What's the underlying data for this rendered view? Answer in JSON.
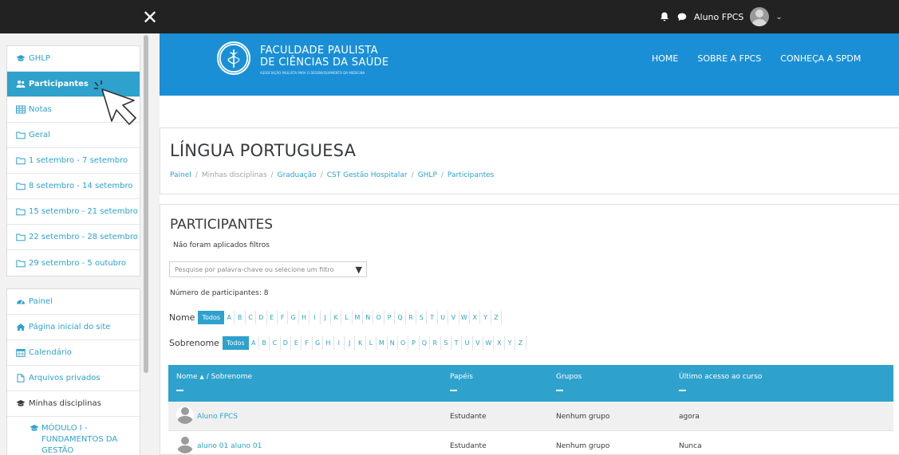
{
  "topbar": {
    "close_glyph": "✕",
    "user_name": "Aluno FPCS",
    "caret": "⌄",
    "icons": [
      "bell-icon",
      "chat-icon"
    ]
  },
  "sidebar": {
    "course_items": [
      {
        "label": "GHLP",
        "icon": "graduation-cap-icon",
        "active": false
      },
      {
        "label": "Participantes",
        "icon": "users-icon",
        "active": true
      },
      {
        "label": "Notas",
        "icon": "table-icon",
        "active": false
      },
      {
        "label": "Geral",
        "icon": "folder-icon",
        "active": false
      },
      {
        "label": "1 setembro - 7 setembro",
        "icon": "folder-icon",
        "active": false
      },
      {
        "label": "8 setembro - 14 setembro",
        "icon": "folder-icon",
        "active": false
      },
      {
        "label": "15 setembro - 21 setembro",
        "icon": "folder-icon",
        "active": false
      },
      {
        "label": "22 setembro - 28 setembro",
        "icon": "folder-icon",
        "active": false
      },
      {
        "label": "29 setembro - 5 outubro",
        "icon": "folder-icon",
        "active": false
      }
    ],
    "site_items": [
      {
        "label": "Painel",
        "icon": "dashboard-icon"
      },
      {
        "label": "Página inicial do site",
        "icon": "home-icon"
      },
      {
        "label": "Calendário",
        "icon": "calendar-icon"
      },
      {
        "label": "Arquivos privados",
        "icon": "file-icon"
      },
      {
        "label": "Minhas disciplinas",
        "icon": "graduation-cap-icon"
      }
    ],
    "sub_item": "MÓDULO I - FUNDAMENTOS DA GESTÃO"
  },
  "header": {
    "brand_line1": "FACULDADE PAULISTA",
    "brand_line2": "DE CIÊNCIAS DA SAÚDE",
    "brand_line3": "ASSOCIAÇÃO PAULISTA PARA O DESENVOLVIMENTO DA MEDICINA",
    "logo_text": "SPDM",
    "nav": [
      "HOME",
      "SOBRE A FPCS",
      "CONHEÇA A SPDM"
    ]
  },
  "page": {
    "title": "LÍNGUA PORTUGUESA",
    "breadcrumb": [
      "Painel",
      "Minhas disciplinas",
      "Graduação",
      "CST Gestão Hospitalar",
      "GHLP",
      "Participantes"
    ],
    "breadcrumb_sep": "/"
  },
  "participants": {
    "title": "PARTICIPANTES",
    "no_filters": "Não foram aplicados filtros",
    "filter_placeholder": "Pesquise por palavra-chave ou selecione um filtro",
    "count_text": "Número de participantes: 8",
    "first_name_label": "Nome",
    "last_name_label": "Sobrenome",
    "all_label": "Todos",
    "letters": [
      "A",
      "B",
      "C",
      "D",
      "E",
      "F",
      "G",
      "H",
      "I",
      "J",
      "K",
      "L",
      "M",
      "N",
      "O",
      "P",
      "Q",
      "R",
      "S",
      "T",
      "U",
      "V",
      "W",
      "X",
      "Y",
      "Z"
    ],
    "columns": {
      "name": "Nome",
      "sort_glyph": "▲",
      "surname": "/ Sobrenome",
      "roles": "Papéis",
      "groups": "Grupos",
      "last_access": "Último acesso ao curso"
    },
    "rows": [
      {
        "name": "Aluno FPCS",
        "role": "Estudante",
        "group": "Nenhum grupo",
        "access": "agora"
      },
      {
        "name": "aluno 01 aluno 01",
        "role": "Estudante",
        "group": "Nenhum grupo",
        "access": "Nunca"
      }
    ]
  },
  "colors": {
    "brand_blue": "#1a8fd6",
    "accent": "#2ea2cc",
    "topbar": "#222222"
  }
}
